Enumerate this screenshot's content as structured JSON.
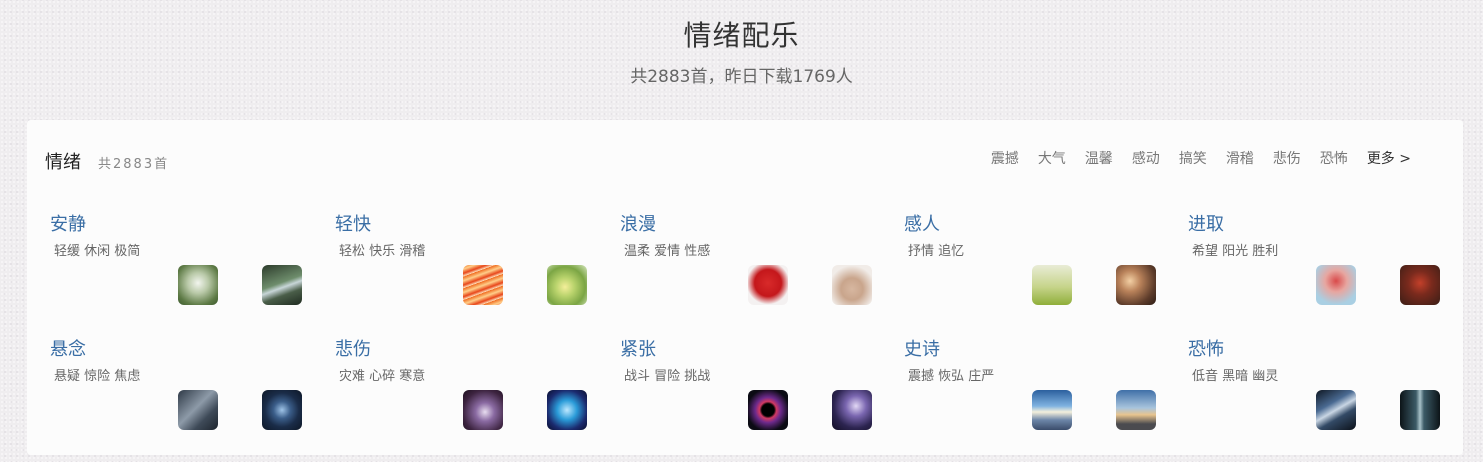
{
  "header": {
    "title": "情绪配乐",
    "subtitle": "共2883首，昨日下载1769人"
  },
  "panel": {
    "title": "情绪",
    "count": "共2883首",
    "quick_tags": [
      "震撼",
      "大气",
      "温馨",
      "感动",
      "搞笑",
      "滑稽",
      "悲伤",
      "恐怖"
    ],
    "more": "更多 >"
  },
  "categories": [
    {
      "name": "安静",
      "tags": "轻缓 休闲 极简",
      "thumbs": [
        "forest-light-image",
        "forest-path-image"
      ]
    },
    {
      "name": "轻快",
      "tags": "轻松 快乐 滑稽",
      "thumbs": [
        "orange-streaks-image",
        "green-flower-image"
      ]
    },
    {
      "name": "浪漫",
      "tags": "温柔 爱情 性感",
      "thumbs": [
        "red-heart-image",
        "hands-image"
      ]
    },
    {
      "name": "感人",
      "tags": "抒情 追忆",
      "thumbs": [
        "tree-meadow-image",
        "bokeh-image"
      ]
    },
    {
      "name": "进取",
      "tags": "希望 阳光 胜利",
      "thumbs": [
        "athlete-image",
        "balloon-image"
      ]
    },
    {
      "name": "悬念",
      "tags": "悬疑 惊险 焦虑",
      "thumbs": [
        "machine-image",
        "eye-image"
      ]
    },
    {
      "name": "悲伤",
      "tags": "灾难 心碎 寒意",
      "thumbs": [
        "purple-figure-image",
        "blue-smoke-image"
      ]
    },
    {
      "name": "紧张",
      "tags": "战斗 冒险 挑战",
      "thumbs": [
        "black-hole-image",
        "galaxy-image"
      ]
    },
    {
      "name": "史诗",
      "tags": "震撼 恢弘 庄严",
      "thumbs": [
        "sunrise-city-image",
        "dusk-sky-image"
      ]
    },
    {
      "name": "恐怖",
      "tags": "低音 黑暗 幽灵",
      "thumbs": [
        "dark-street-image",
        "dark-corridor-image"
      ]
    }
  ]
}
